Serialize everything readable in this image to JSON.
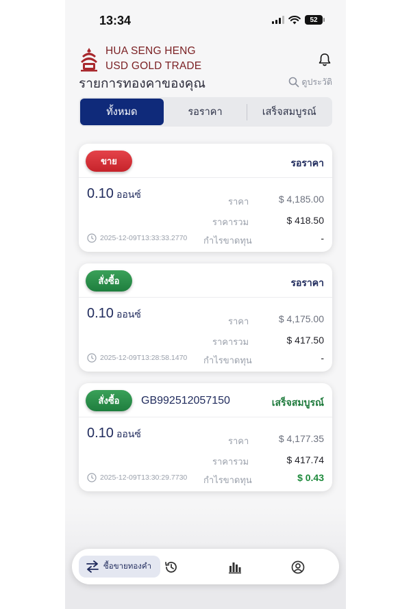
{
  "status_bar": {
    "time": "13:34",
    "battery": "52"
  },
  "header": {
    "brand_line1": "HUA SENG HENG",
    "brand_line2": "USD GOLD TRADE",
    "title": "รายการทองคาของคุณ",
    "history_link": "ดูประวัติ"
  },
  "tabs": [
    {
      "label": "ทั้งหมด",
      "active": true
    },
    {
      "label": "รอราคา",
      "active": false
    },
    {
      "label": "เสร็จสมบูรณ์",
      "active": false
    }
  ],
  "labels": {
    "price": "ราคา",
    "total": "ราคารวม",
    "pnl": "กำไรขาดทุน"
  },
  "orders": [
    {
      "type": "ขาย",
      "type_kind": "sell",
      "order_id": "",
      "status": "รอราคา",
      "amount": "0.10",
      "unit": "ออนซ์",
      "price": "$ 4,185.00",
      "total": "$ 418.50",
      "timestamp": "2025-12-09T13:33:33.2770",
      "pnl": "-"
    },
    {
      "type": "สั่งซื้อ",
      "type_kind": "buy",
      "order_id": "",
      "status": "รอราคา",
      "amount": "0.10",
      "unit": "ออนซ์",
      "price": "$ 4,175.00",
      "total": "$ 417.50",
      "timestamp": "2025-12-09T13:28:58.1470",
      "pnl": "-"
    },
    {
      "type": "สั่งซื้อ",
      "type_kind": "buy",
      "order_id": "GB992512057150",
      "status": "เสร็จสมบูรณ์",
      "amount": "0.10",
      "unit": "ออนซ์",
      "price": "$ 4,177.35",
      "total": "$ 417.74",
      "timestamp": "2025-12-09T13:30:29.7730",
      "pnl": "$ 0.43"
    }
  ],
  "bottom_nav": {
    "active_label": "ซื้อขายทองคำ",
    "icons": [
      "swap-arrows-icon",
      "history-icon",
      "bar-chart-icon",
      "profile-icon"
    ]
  },
  "colors": {
    "brand": "#7a1f22",
    "primary": "#0f2a7a",
    "sell": "#d42f36",
    "buy": "#258a47",
    "success": "#1e7a3c"
  }
}
